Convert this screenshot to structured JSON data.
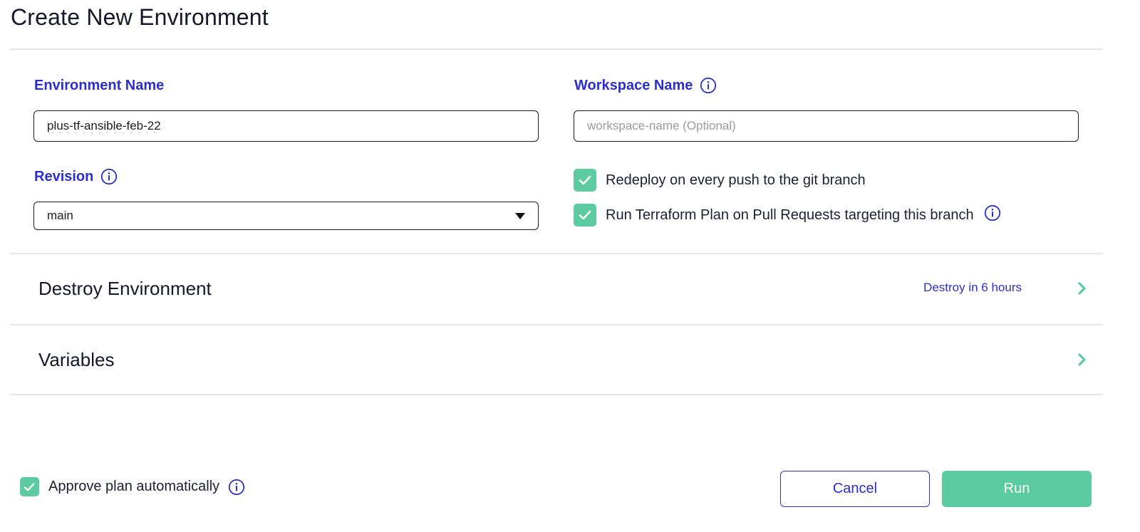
{
  "page": {
    "title": "Create New Environment"
  },
  "form": {
    "environment_name": {
      "label": "Environment Name",
      "value": "plus-tf-ansible-feb-22"
    },
    "workspace_name": {
      "label": "Workspace Name",
      "value": "",
      "placeholder": "workspace-name (Optional)"
    },
    "revision": {
      "label": "Revision",
      "selected": "main"
    },
    "options": [
      {
        "label": "Redeploy on every push to the git branch",
        "checked": true
      },
      {
        "label": "Run Terraform Plan on Pull Requests targeting this branch",
        "checked": true
      }
    ]
  },
  "sections": {
    "destroy": {
      "title": "Destroy Environment",
      "status": "Destroy in 6 hours"
    },
    "variables": {
      "title": "Variables"
    }
  },
  "footer": {
    "approve_label": "Approve plan automatically",
    "approve_checked": true,
    "cancel_label": "Cancel",
    "run_label": "Run"
  },
  "colors": {
    "accent_blue": "#2b2fcf",
    "accent_green": "#5ccba2",
    "divider": "#e6e6ea"
  },
  "icons": {
    "info": "info-icon",
    "check": "check-icon",
    "chevron": "chevron-right-icon",
    "caret": "caret-down-icon"
  }
}
